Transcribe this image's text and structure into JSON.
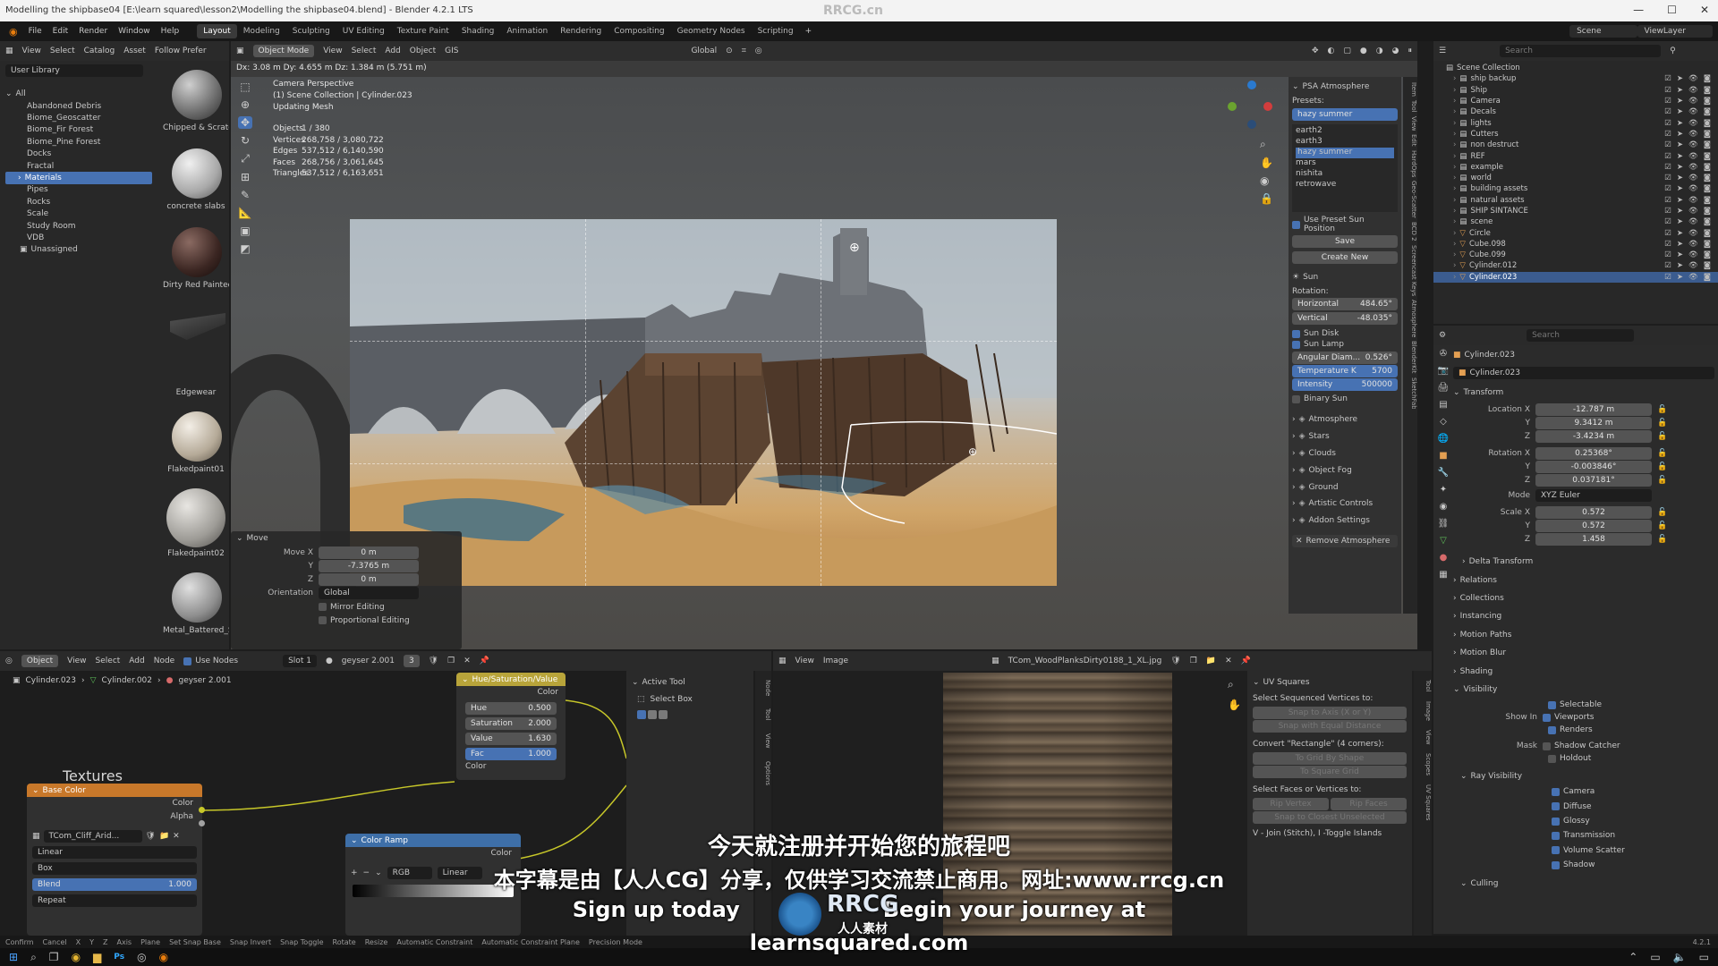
{
  "window": {
    "title": "Modelling the shipbase04 [E:\\learn squared\\lesson2\\Modelling the shipbase04.blend] - Blender 4.2.1 LTS",
    "watermark_top": "RRCG.cn"
  },
  "menu": {
    "items": [
      "File",
      "Edit",
      "Render",
      "Window",
      "Help"
    ],
    "workspaces": [
      "Layout",
      "Modeling",
      "Sculpting",
      "UV Editing",
      "Texture Paint",
      "Shading",
      "Animation",
      "Rendering",
      "Compositing",
      "Geometry Nodes",
      "Scripting"
    ],
    "active_workspace": "Layout",
    "scene_label": "Scene",
    "viewlayer_label": "ViewLayer"
  },
  "asset_browser": {
    "header_items": [
      "View",
      "Select",
      "Catalog",
      "Asset",
      "Follow Prefer"
    ],
    "library": "User Library",
    "tree_root": "All",
    "catalogs": [
      "Abandoned Debris",
      "Biome_Geoscatter",
      "Biome_Fir Forest",
      "Biome_Pine Forest",
      "Docks",
      "Fractal",
      "Materials",
      "Pipes",
      "Rocks",
      "Scale",
      "Study Room",
      "VDB",
      "Unassigned"
    ],
    "selected_catalog": "Materials",
    "assets": [
      "Chipped & Scratc",
      "concrete slabs",
      "Dirty Red Painted",
      "Edgewear",
      "Flakedpaint01",
      "Flakedpaint02",
      "Metal_Battered_S"
    ]
  },
  "viewport": {
    "header": [
      "Object Mode",
      "View",
      "Select",
      "Add",
      "Object",
      "GIS"
    ],
    "transform_orientation": "Global",
    "status_line": "Dx: 3.08 m  Dy: 4.655 m  Dz: 1.384 m (5.751 m)",
    "camera_info": [
      "Camera Perspective",
      "(1) Scene Collection | Cylinder.023",
      "Updating Mesh"
    ],
    "stats": [
      {
        "label": "Objects",
        "value": "1 / 380"
      },
      {
        "label": "Vertices",
        "value": "268,758 / 3,080,722"
      },
      {
        "label": "Edges",
        "value": "537,512 / 6,140,590"
      },
      {
        "label": "Faces",
        "value": "268,756 / 3,061,645"
      },
      {
        "label": "Triangles",
        "value": "537,512 / 6,163,651"
      }
    ],
    "operator_panel": {
      "title": "Move",
      "move_x_label": "Move X",
      "move_x": "0 m",
      "y_label": "Y",
      "move_y": "-7.3765 m",
      "z_label": "Z",
      "move_z": "0 m",
      "orientation_label": "Orientation",
      "orientation": "Global",
      "mirror": "Mirror Editing",
      "proportional": "Proportional Editing"
    }
  },
  "atmosphere": {
    "title": "PSA Atmosphere",
    "presets_label": "Presets:",
    "preset_selected": "hazy summer",
    "preset_list": [
      "earth2",
      "earth3",
      "hazy summer",
      "mars",
      "nishita",
      "retrowave"
    ],
    "use_preset_sun": "Use Preset Sun Position",
    "save": "Save",
    "create_new": "Create New",
    "sun_section": "Sun",
    "rotation_label": "Rotation:",
    "horizontal_label": "Horizontal",
    "horizontal": "484.65°",
    "vertical_label": "Vertical",
    "vertical": "-48.035°",
    "sun_disk": "Sun Disk",
    "sun_lamp": "Sun Lamp",
    "angular_label": "Angular Diam...",
    "angular": "0.526°",
    "temperature_label": "Temperature K",
    "temperature": "5700",
    "intensity_label": "Intensity",
    "intensity": "500000",
    "binary_sun": "Binary Sun",
    "sections": [
      "Atmosphere",
      "Stars",
      "Clouds",
      "Object Fog",
      "Ground",
      "Artistic Controls",
      "Addon Settings"
    ],
    "remove": "Remove Atmosphere",
    "side_tabs": [
      "Item",
      "Tool",
      "View",
      "Edit",
      "HardOps",
      "Geo-Scatter",
      "BCD 2",
      "Screencast Keys",
      "Atmosphere",
      "BlenderKit",
      "SketchFab"
    ]
  },
  "outliner": {
    "search_placeholder": "Search",
    "root": "Scene Collection",
    "items": [
      "ship backup",
      "Ship",
      "Camera",
      "Decals",
      "lights",
      "Cutters",
      "non destruct",
      "REF",
      "example",
      "world",
      "building assets",
      "natural assets",
      "SHIP SINTANCE",
      "scene",
      "Circle",
      "Cube.098",
      "Cube.099",
      "Cylinder.012",
      "Cylinder.023"
    ],
    "selected": "Cylinder.023"
  },
  "properties": {
    "object_name": "Cylinder.023",
    "object_field": "Cylinder.023",
    "transform_title": "Transform",
    "location_label": "Location X",
    "location": [
      "-12.787 m",
      "9.3412 m",
      "-3.4234 m"
    ],
    "rotation_label": "Rotation X",
    "rotation": [
      "0.25368°",
      "-0.003846°",
      "0.037181°"
    ],
    "mode_label": "Mode",
    "mode": "XYZ Euler",
    "scale_label": "Scale X",
    "scale": [
      "0.572",
      "0.572",
      "1.458"
    ],
    "axis_y": "Y",
    "axis_z": "Z",
    "sections": [
      "Delta Transform",
      "Relations",
      "Collections",
      "Instancing",
      "Motion Paths",
      "Motion Blur",
      "Shading",
      "Visibility"
    ],
    "visibility": {
      "selectable": "Selectable",
      "show_in_label": "Show In",
      "viewports": "Viewports",
      "renders": "Renders",
      "mask_label": "Mask",
      "shadow_catcher": "Shadow Catcher",
      "holdout": "Holdout",
      "ray_visibility": "Ray Visibility",
      "rays": [
        "Camera",
        "Diffuse",
        "Glossy",
        "Transmission",
        "Volume Scatter",
        "Shadow"
      ],
      "culling": "Culling"
    }
  },
  "node_editor": {
    "header": [
      "Object",
      "View",
      "Select",
      "Add",
      "Node"
    ],
    "use_nodes": "Use Nodes",
    "slot": "Slot 1",
    "material": "geyser 2.001",
    "users": "3",
    "breadcrumb": [
      "Cylinder.023",
      "Cylinder.002",
      "geyser 2.001"
    ],
    "frame_label": "Textures",
    "base_color_node": {
      "title": "Base Color",
      "out_color": "Color",
      "out_alpha": "Alpha",
      "image": "TCom_Cliff_Arid...",
      "interpolation": "Linear",
      "projection": "Box",
      "blend_label": "Blend",
      "blend": "1.000",
      "extension": "Repeat"
    },
    "hsv_node": {
      "title": "Hue/Saturation/Value",
      "out_color": "Color",
      "hue_label": "Hue",
      "hue": "0.500",
      "sat_label": "Saturation",
      "sat": "2.000",
      "val_label": "Value",
      "val": "1.630",
      "fac_label": "Fac",
      "fac": "1.000",
      "in_color": "Color"
    },
    "ramp_node": {
      "title": "Color Ramp",
      "out_color": "Color",
      "mode": "RGB",
      "interp": "Linear"
    },
    "active_tool": "Active Tool",
    "select_box": "Select Box",
    "side_tabs": [
      "Node",
      "Tool",
      "View",
      "Options"
    ]
  },
  "image_editor": {
    "header": [
      "View",
      "Image"
    ],
    "image_name": "TCom_WoodPlanksDirty0188_1_XL.jpg",
    "uv_panel": {
      "title": "UV Squares",
      "seq_label": "Select Sequenced Vertices to:",
      "snap_axis": "Snap to Axis (X or Y)",
      "snap_equal": "Snap with Equal Distance",
      "convert_label": "Convert \"Rectangle\" (4 corners):",
      "grid_shape": "To Grid By Shape",
      "square_grid": "To Square Grid",
      "faces_label": "Select Faces or Vertices to:",
      "rip_vertex": "Rip Vertex",
      "rip_faces": "Rip Faces",
      "snap_closest": "Snap to Closest Unselected",
      "join": "V - Join (Stitch), I -Toggle Islands"
    },
    "side_tabs": [
      "Tool",
      "Image",
      "View",
      "Scopes",
      "UV Squares"
    ]
  },
  "statusbar": {
    "items": [
      "Confirm",
      "Cancel",
      "X",
      "Y",
      "Z",
      "Axis",
      "Plane",
      "Set Snap Base",
      "Snap Invert",
      "Snap Toggle",
      "Rotate",
      "Resize",
      "Automatic Constraint",
      "Automatic Constraint Plane",
      "Precision Mode"
    ],
    "version": "4.2.1"
  },
  "subtitles": {
    "line1": "今天就注册并开始您的旅程吧",
    "line2": "本字幕是由【人人CG】分享，仅供学习交流禁止商用。网址:www.rrcg.cn",
    "line3": "Sign up today",
    "line3b": "Begin your journey at",
    "line4": "learnsquared.com",
    "logo_text": "RRCG",
    "logo_sub": "人人素材"
  },
  "colors": {
    "accent_blue": "#4772b3",
    "node_orange": "#c8782a",
    "node_yellow": "#b8a43a",
    "node_ramp": "#3e6fa8"
  }
}
